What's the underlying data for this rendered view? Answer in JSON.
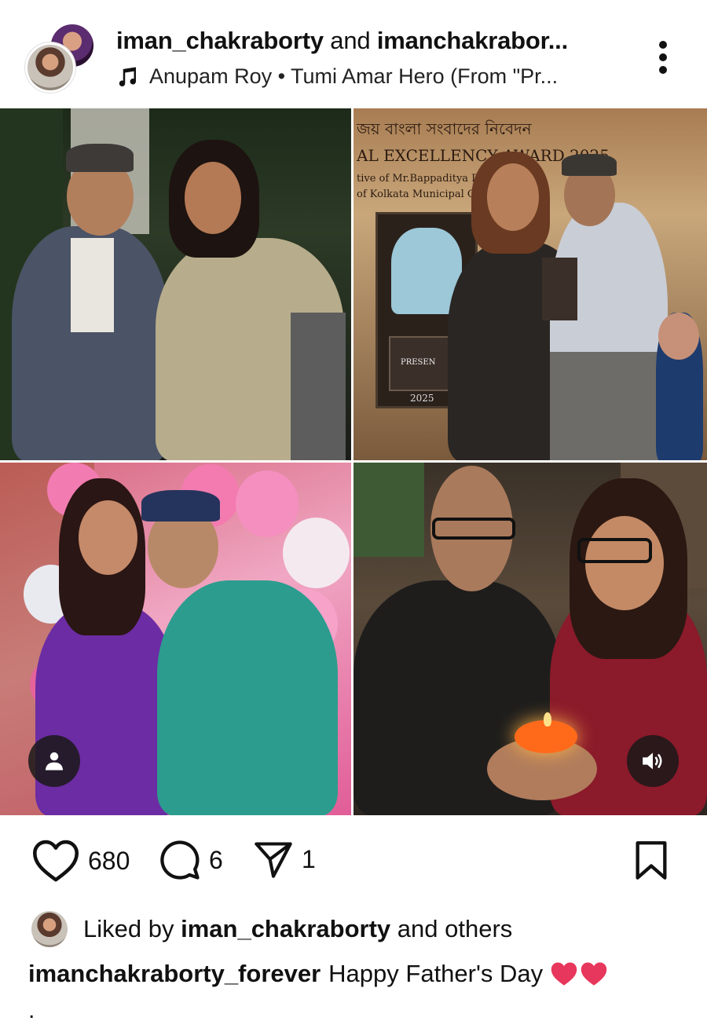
{
  "header": {
    "user_primary": "iman_chakraborty",
    "connector": "and",
    "user_secondary": "imanchakrabor...",
    "song": "Anupam Roy • Tumi Amar Hero (From \"Pr...",
    "icons": {
      "music": "music-note-icon",
      "more": "more-vertical-icon"
    }
  },
  "photos": {
    "tile_2_banner_1": "জয় বাংলা সংবাদের নিবেদন",
    "tile_2_banner_2": "AL EXCELLENCY AWARD 2025",
    "tile_2_banner_3": "tive of Mr.Bappaditya Da",
    "tile_2_banner_4": "of Kolkata Municipal Corp",
    "tile_2_trophy_1": "PRESEN",
    "tile_2_trophy_2": "2025"
  },
  "overlay": {
    "tag_icon": "person-icon",
    "sound_icon": "speaker-icon"
  },
  "actions": {
    "like_count": "680",
    "comment_count": "6",
    "share_count": "1",
    "icons": {
      "like": "heart-icon",
      "comment": "comment-icon",
      "share": "send-icon",
      "save": "bookmark-icon"
    }
  },
  "likes": {
    "prefix": "Liked by",
    "user": "iman_chakraborty",
    "suffix": "and others"
  },
  "caption": {
    "user": "imanchakraborty_forever",
    "text": "Happy Father's Day",
    "emoji": "❤️❤️",
    "trailing": "."
  },
  "colors": {
    "heart_emoji": "#e8375c",
    "text": "#111111",
    "background": "#ffffff"
  }
}
